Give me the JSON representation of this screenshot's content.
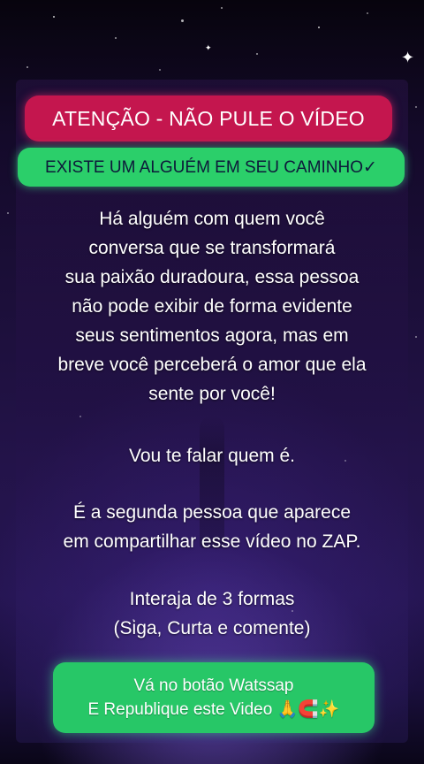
{
  "header": {
    "alert": "ATENÇÃO - NÃO PULE O VÍDEO",
    "subtitle": "EXISTE UM ALGUÉM EM SEU CAMINHO✓"
  },
  "message": {
    "paragraph1": "Há alguém com quem você\nconversa que se transformará\nsua paixão duradoura, essa pessoa\nnão pode exibir de forma evidente\nseus sentimentos agora, mas em\nbreve você perceberá o amor que ela\nsente por você!",
    "paragraph2": "Vou te falar quem é.",
    "paragraph3": "É a segunda pessoa que aparece\nem compartilhar esse vídeo no ZAP.",
    "paragraph4": "Interaja de 3 formas\n(Siga, Curta e comente)"
  },
  "cta": {
    "line1": "Vá no botão Watssap",
    "line2": "E Republique este Video 🙏🧲✨"
  },
  "colors": {
    "alert_bg": "#c4164e",
    "subtitle_bg": "#2bcf6a",
    "cta_bg": "#27c767",
    "text": "#ffffff"
  }
}
